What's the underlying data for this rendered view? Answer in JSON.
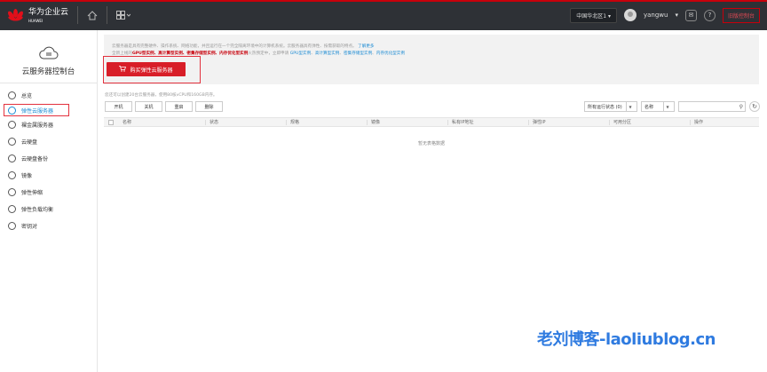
{
  "topbar": {
    "brand_cn": "华为企业云",
    "brand_en": "HUAWEI",
    "region": "中国华北区1",
    "username": "yangwu",
    "console_label": "旧版控制台",
    "accent_color": "#c7000b",
    "icons": [
      "home-icon",
      "apps-icon",
      "mail-icon",
      "help-icon"
    ]
  },
  "sidebar": {
    "title": "云服务器控制台",
    "items": [
      {
        "label": "总览",
        "icon": "overview-icon"
      },
      {
        "label": "弹性云服务器",
        "icon": "ecs-icon",
        "active": true
      },
      {
        "label": "裸金属服务器",
        "icon": "bms-icon"
      },
      {
        "label": "云硬盘",
        "icon": "disk-icon"
      },
      {
        "label": "云硬盘备份",
        "icon": "backup-icon"
      },
      {
        "label": "镜像",
        "icon": "image-icon"
      },
      {
        "label": "弹性伸缩",
        "icon": "autoscale-icon"
      },
      {
        "label": "弹性负载均衡",
        "icon": "lb-icon"
      },
      {
        "label": "密钥对",
        "icon": "key-icon"
      }
    ]
  },
  "banner": {
    "line1": "云服务器是具有完整硬件、操作系统、网络功能，并且运行在一个完全隔离环境中的计算机系统。云服务器具有弹性、按需获取的特点。",
    "line1_link": "了解更多",
    "line2_prefix": "全新上线的",
    "line2_red": "GPU型实例、高计算型实例、密集存储型实例、内存优化型实例",
    "line2_mid": "火热预定中，立即申请",
    "line2_links": [
      "GPU型实例",
      "高计算型实例",
      "密集存储型实例",
      "内存优化型实例"
    ],
    "buy_button": "购买弹性云服务器"
  },
  "quota_text": "您还可以创建20台云服务器，使用80核vCPU和160GB内存。",
  "actions": [
    "开机",
    "关机",
    "重启",
    "删除"
  ],
  "filter": {
    "status_select": "所有运行状态 (0)",
    "field_select": "名称",
    "search_placeholder": ""
  },
  "table": {
    "columns": [
      "名称",
      "状态",
      "规格",
      "镜像",
      "私有IP地址",
      "弹性IP",
      "可用分区",
      "操作"
    ],
    "empty_text": "暂无表格数据"
  },
  "watermark": "老刘博客-laoliublog.cn"
}
